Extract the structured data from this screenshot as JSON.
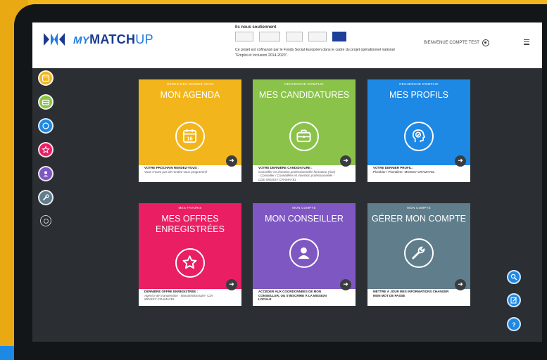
{
  "app": {
    "logo_my": "MY",
    "logo_match": "MATCH",
    "logo_up": "UP"
  },
  "header": {
    "support_title": "Ils nous soutiennent",
    "partners": [
      "partner-logo-1",
      "partner-logo-2",
      "partner-logo-3",
      "partner-logo-grand-paris-sud",
      "partner-logo-eu-flag"
    ],
    "support_note": "Ce projet est cofinancé par le Fonds Social Européen dans le cadre du projet opérationnel national \"Emploi et Inclusion 2014-2020\".",
    "welcome": "BIENVENUE COMPTE TEST"
  },
  "sidebar": {
    "items": [
      {
        "name": "agenda",
        "color": "#f2b61c",
        "icon": "calendar-icon"
      },
      {
        "name": "candidatures",
        "color": "#8bc34a",
        "icon": "briefcase-icon"
      },
      {
        "name": "profils",
        "color": "#1e88e5",
        "icon": "profile-head-icon"
      },
      {
        "name": "offres",
        "color": "#e91e63",
        "icon": "star-icon"
      },
      {
        "name": "conseiller",
        "color": "#7e57c2",
        "icon": "person-icon"
      },
      {
        "name": "compte",
        "color": "#607d8b",
        "icon": "wrench-icon"
      }
    ]
  },
  "tiles": [
    {
      "category": "Gérer mes rendez-vous",
      "title": "MON AGENDA",
      "color": "#f2b61c",
      "icon": "calendar-icon",
      "foot_title": "VOTRE PROCHAIN RENDEZ-VOUS :",
      "foot_text": "Vous n'avez pas de rendez-vous programmé"
    },
    {
      "category": "Recherche d'emploi",
      "title": "MES CANDIDATURES",
      "color": "#8bc34a",
      "icon": "briefcase-icon",
      "foot_title": "VOTRE DERNIÈRE CANDIDATURE :",
      "foot_text": "Conseiller en insertion professionnelle/ formateur (rice) - Conseiller / Conseillère en insertion professionnelle - CDD MOISSY CRAMAYEL"
    },
    {
      "category": "Recherche d'emploi",
      "title": "MES PROFILS",
      "color": "#1e88e5",
      "icon": "profile-head-icon",
      "foot_title": "VOTRE DERNIER PROFIL :",
      "foot_text": "Plombier / Plombière- MOISSY CRAMAYEL"
    },
    {
      "category": "Mes favoris",
      "title": "MES OFFRES ENREGISTRÉES",
      "color": "#e91e63",
      "icon": "star-icon",
      "foot_title": "DERNIÈRE OFFRE ENREGISTRÉE :",
      "foot_text": "Agent.e de manutention - Manutentionnaire- CDI MOISSY CRAMAYEL"
    },
    {
      "category": "Mon compte",
      "title": "MON CONSEILLER",
      "color": "#7e57c2",
      "icon": "person-icon",
      "foot_title": "ACCÉDER AUX COORDONNÉES DE MON CONSEILLER, OU S'INSCRIRE À LA MISSION LOCALE",
      "foot_text": ""
    },
    {
      "category": "Mon compte",
      "title": "GÉRER MON COMPTE",
      "color": "#607d8b",
      "icon": "wrench-icon",
      "foot_title": "METTRE À JOUR MES INFORMATIONS CHANGER MON MOT DE PASSE",
      "foot_text": ""
    }
  ],
  "tile_arrow": "➜",
  "fabs": [
    {
      "icon": "search-icon"
    },
    {
      "icon": "edit-icon"
    },
    {
      "icon": "help-icon",
      "label": "?"
    }
  ]
}
